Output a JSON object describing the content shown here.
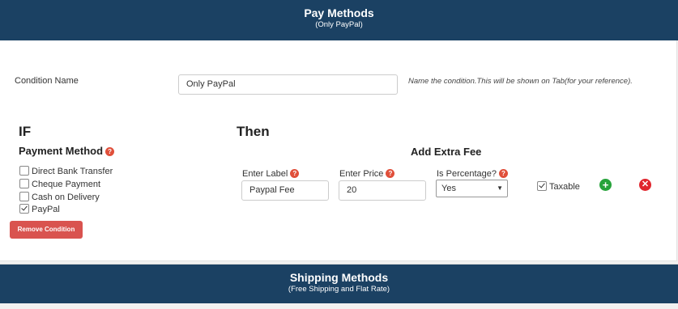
{
  "pay_methods": {
    "title": "Pay Methods",
    "subtitle": "(Only PayPal)"
  },
  "condition": {
    "label": "Condition Name",
    "value": "Only PayPal",
    "hint": "Name the condition.This will be shown on Tab(for your reference)."
  },
  "if_section": {
    "heading": "IF",
    "payment_method_label": "Payment Method",
    "options": [
      {
        "label": "Direct Bank Transfer",
        "checked": false
      },
      {
        "label": "Cheque Payment",
        "checked": false
      },
      {
        "label": "Cash on Delivery",
        "checked": false
      },
      {
        "label": "PayPal",
        "checked": true
      }
    ],
    "remove_button": "Remove Condition"
  },
  "then_section": {
    "heading": "Then",
    "add_fee_heading": "Add Extra Fee",
    "label_field": {
      "label": "Enter Label",
      "value": "Paypal Fee"
    },
    "price_field": {
      "label": "Enter Price",
      "value": "20"
    },
    "percentage_field": {
      "label": "Is Percentage?",
      "value": "Yes"
    },
    "taxable": {
      "label": "Taxable",
      "checked": true
    }
  },
  "shipping_methods": {
    "title": "Shipping Methods",
    "subtitle": "(Free Shipping and Flat Rate)"
  },
  "colors": {
    "header_bg": "#1b4163",
    "remove_btn": "#d9534f",
    "add_icon": "#27a33b",
    "delete_icon": "#e0262e",
    "help_icon": "#e04f3a"
  },
  "icons": {
    "help": "question-circle-icon",
    "add": "plus-circle-icon",
    "delete": "times-circle-icon"
  }
}
